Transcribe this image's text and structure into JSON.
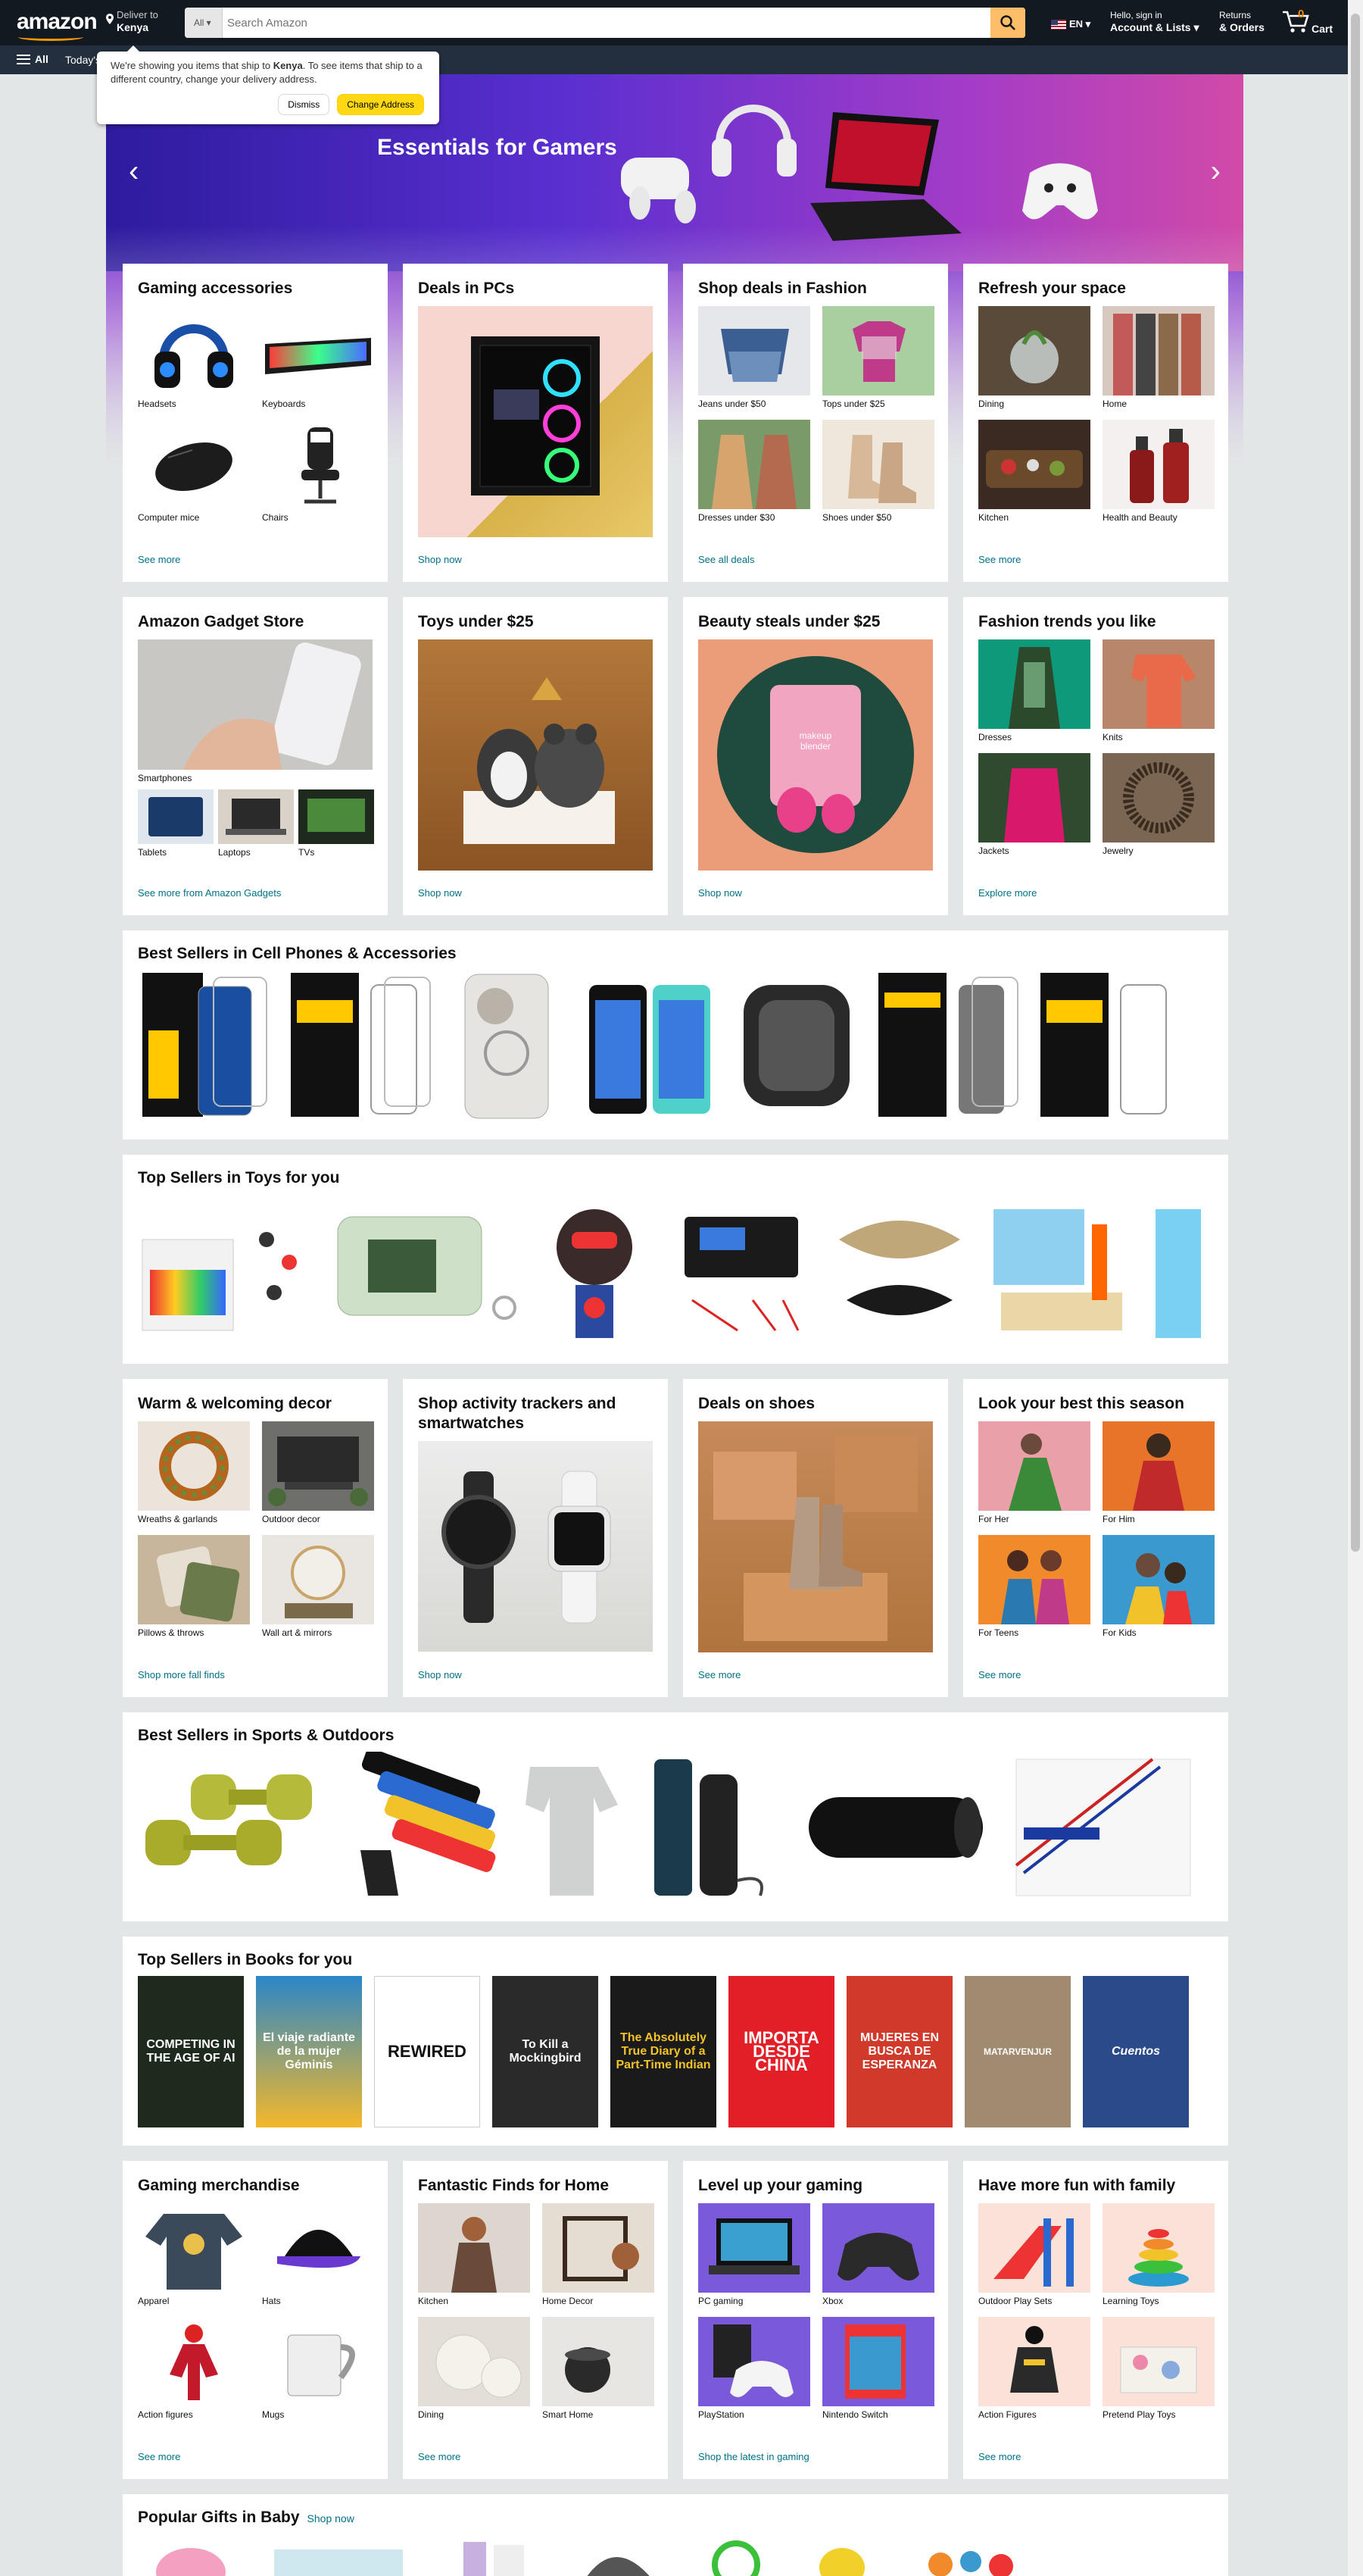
{
  "header": {
    "logo": "amazon",
    "deliver_to_label": "Deliver to",
    "deliver_to_location": "Kenya",
    "search_category": "All",
    "search_placeholder": "Search Amazon",
    "language": "EN",
    "account_greeting": "Hello, sign in",
    "account_label": "Account & Lists",
    "returns_label": "Returns",
    "orders_label": "& Orders",
    "cart_count": "0",
    "cart_label": "Cart"
  },
  "subnav": {
    "all_label": "All",
    "today_label": "Today's"
  },
  "popover": {
    "text_before": "We're showing you items that ship to ",
    "country": "Kenya",
    "text_after": ". To see items that ship to a different country, change your delivery address.",
    "dismiss_label": "Dismiss",
    "change_label": "Change Address"
  },
  "hero": {
    "title": "Essentials for Gamers"
  },
  "cards": {
    "gaming": {
      "title": "Gaming accessories",
      "items": [
        "Headsets",
        "Keyboards",
        "Computer mice",
        "Chairs"
      ],
      "link": "See more"
    },
    "pcs": {
      "title": "Deals in PCs",
      "link": "Shop now"
    },
    "fashion": {
      "title": "Shop deals in Fashion",
      "items": [
        "Jeans under $50",
        "Tops under $25",
        "Dresses under $30",
        "Shoes under $50"
      ],
      "link": "See all deals"
    },
    "refresh": {
      "title": "Refresh your space",
      "items": [
        "Dining",
        "Home",
        "Kitchen",
        "Health and Beauty"
      ],
      "link": "See more"
    },
    "gadget": {
      "title": "Amazon Gadget Store",
      "main_item": "Smartphones",
      "items": [
        "Tablets",
        "Laptops",
        "TVs"
      ],
      "link": "See more from Amazon Gadgets"
    },
    "toys": {
      "title": "Toys under $25",
      "link": "Shop now"
    },
    "beauty": {
      "title": "Beauty steals under $25",
      "link": "Shop now",
      "product_text": "makeup blender"
    },
    "trends": {
      "title": "Fashion trends you like",
      "items": [
        "Dresses",
        "Knits",
        "Jackets",
        "Jewelry"
      ],
      "link": "Explore more"
    },
    "decor": {
      "title": "Warm & welcoming decor",
      "items": [
        "Wreaths & garlands",
        "Outdoor decor",
        "Pillows & throws",
        "Wall art & mirrors"
      ],
      "link": "Shop more fall finds"
    },
    "trackers": {
      "title": "Shop activity trackers and smartwatches",
      "link": "Shop now"
    },
    "shoes": {
      "title": "Deals on shoes",
      "link": "See more"
    },
    "season": {
      "title": "Look your best this season",
      "items": [
        "For Her",
        "For Him",
        "For Teens",
        "For Kids"
      ],
      "link": "See more"
    },
    "merch": {
      "title": "Gaming merchandise",
      "items": [
        "Apparel",
        "Hats",
        "Action figures",
        "Mugs"
      ],
      "link": "See more"
    },
    "home": {
      "title": "Fantastic Finds for Home",
      "items": [
        "Kitchen",
        "Home Decor",
        "Dining",
        "Smart Home"
      ],
      "link": "See more"
    },
    "levelup": {
      "title": "Level up your gaming",
      "items": [
        "PC gaming",
        "Xbox",
        "PlayStation",
        "Nintendo Switch"
      ],
      "link": "Shop the latest in gaming"
    },
    "family": {
      "title": "Have more fun with family",
      "items": [
        "Outdoor Play Sets",
        "Learning Toys",
        "Action Figures",
        "Pretend Play Toys"
      ],
      "link": "See more"
    }
  },
  "strips": {
    "phones": {
      "title": "Best Sellers in Cell Phones & Accessories"
    },
    "toys": {
      "title": "Top Sellers in Toys for you"
    },
    "sports": {
      "title": "Best Sellers in Sports & Outdoors"
    },
    "books": {
      "title": "Top Sellers in Books for you",
      "covers": [
        "COMPETING IN THE AGE OF AI",
        "El viaje radiante de la mujer Géminis",
        "REWIRED",
        "To Kill a Mockingbird",
        "The Absolutely True Diary of a Part-Time Indian",
        "IMPORTA DESDE CHINA",
        "MUJERES EN BUSCA DE ESPERANZA",
        "MATARVENJUR",
        "Cuentos"
      ]
    },
    "baby": {
      "title": "Popular Gifts in Baby",
      "link": "Shop now"
    }
  },
  "colors": {
    "accent": "#febd69",
    "header": "#131921",
    "subnav": "#232f3e",
    "link": "#007185",
    "button_yellow": "#ffd814"
  }
}
